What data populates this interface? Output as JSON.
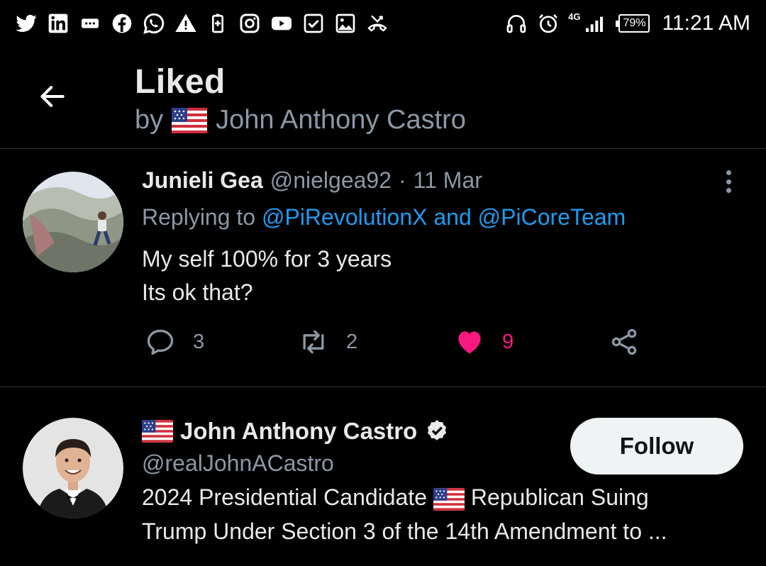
{
  "status_bar": {
    "time": "11:21 AM",
    "battery": "79%",
    "network": "4G",
    "left_icons": [
      "twitter-icon",
      "linkedin-icon",
      "sms-icon",
      "facebook-icon",
      "whatsapp-icon",
      "warning-icon",
      "battery-plus-icon",
      "instagram-icon",
      "youtube-icon",
      "checkbox-icon",
      "gallery-icon",
      "missed-call-icon"
    ],
    "right_icons": [
      "headset-icon",
      "alarm-icon",
      "signal-icon"
    ]
  },
  "header": {
    "title": "Liked",
    "by_label": "by",
    "by_name": "John Anthony Castro"
  },
  "tweet": {
    "name": "Junieli Gea",
    "handle": "@nielgea92",
    "separator": "·",
    "date": "11 Mar",
    "replying_label": "Replying to",
    "reply_to_1": "@PiRevolutionX",
    "and_label": "and",
    "reply_to_2": "@PiCoreTeam",
    "text_line_1": "My self 100% for 3 years",
    "text_line_2": "Its ok that?",
    "reply_count": "3",
    "retweet_count": "2",
    "like_count": "9"
  },
  "user_card": {
    "name": "John Anthony Castro",
    "handle": "@realJohnACastro",
    "follow_label": "Follow",
    "bio_part_1": "2024 Presidential Candidate",
    "bio_part_2": "Republican Suing",
    "bio_line_2": "Trump Under Section 3 of the 14th Amendment to ..."
  },
  "colors": {
    "background": "#000000",
    "primary_text": "#e7e9ea",
    "muted_text": "#8b98a5",
    "link": "#1d9bf0",
    "like": "#f91880",
    "divider": "#2f3336",
    "follow_button": "#eff3f4"
  }
}
